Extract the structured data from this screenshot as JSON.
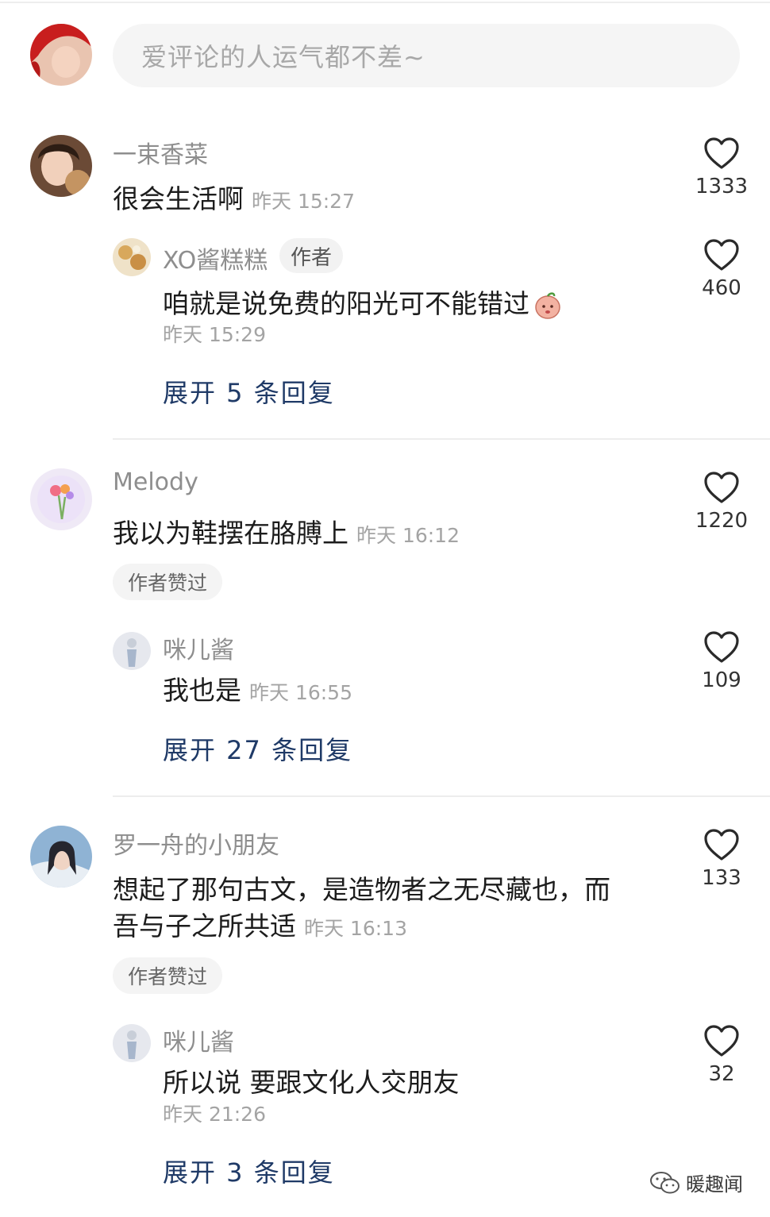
{
  "input": {
    "placeholder": "爱评论的人运气都不差~"
  },
  "threads": [
    {
      "user": "一束香菜",
      "text": "很会生活啊",
      "time": "昨天 15:27",
      "likes": "1333",
      "reply": {
        "user": "XO酱糕糕",
        "tag": "作者",
        "text": "咱就是说免费的阳光可不能错过",
        "time": "昨天 15:29",
        "likes": "460"
      },
      "expand": "展开 5 条回复"
    },
    {
      "user": "Melody",
      "text": "我以为鞋摆在胳膊上",
      "time": "昨天 16:12",
      "likes": "1220",
      "liked_tag": "作者赞过",
      "reply": {
        "user": "咪儿酱",
        "text": "我也是",
        "time": "昨天 16:55",
        "likes": "109"
      },
      "expand": "展开 27 条回复"
    },
    {
      "user": "罗一舟的小朋友",
      "text_line1": "想起了那句古文，是造物者之无尽藏也，而",
      "text_line2": "吾与子之所共适",
      "time": "昨天 16:13",
      "likes": "133",
      "liked_tag": "作者赞过",
      "reply": {
        "user": "咪儿酱",
        "text": "所以说 要跟文化人交朋友",
        "time": "昨天 21:26",
        "likes": "32"
      },
      "expand": "展开 3 条回复"
    }
  ],
  "watermark": {
    "text": "暖趣闻"
  }
}
